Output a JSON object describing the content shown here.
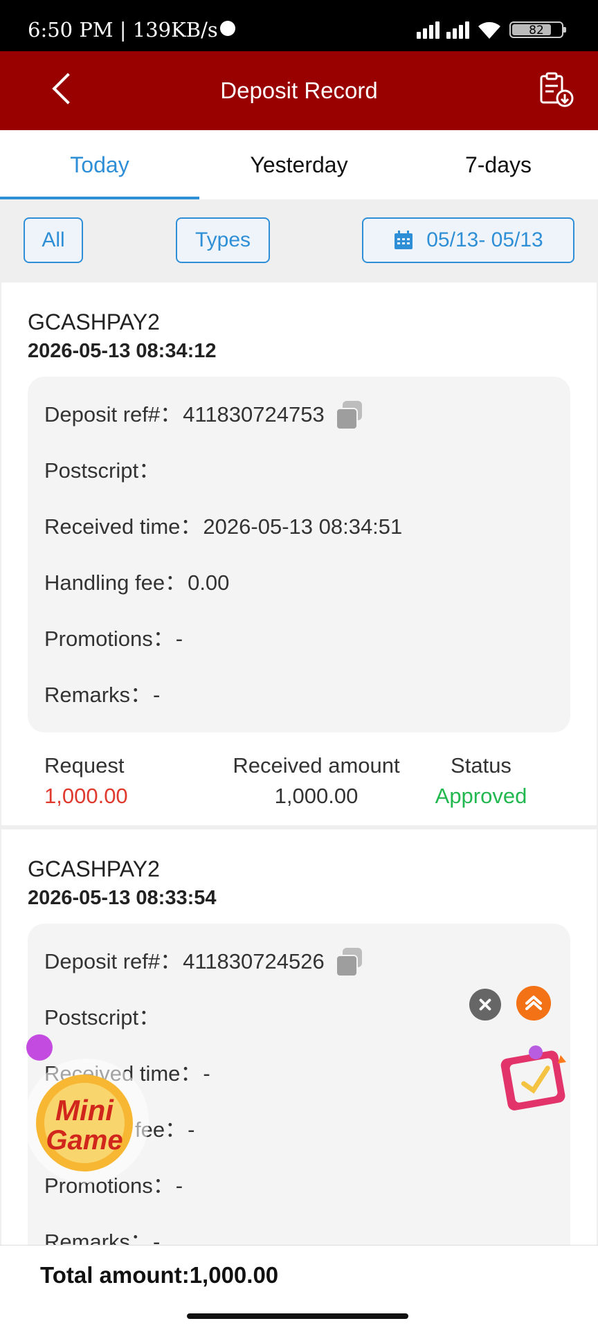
{
  "status_bar": {
    "time": "6:50 PM",
    "separator": "|",
    "speed": "139KB/s",
    "battery": "82"
  },
  "header": {
    "title": "Deposit Record",
    "back_icon": "chevron-left-icon",
    "export_icon": "clipboard-download-icon"
  },
  "tabs": [
    {
      "label": "Today",
      "active": true
    },
    {
      "label": "Yesterday",
      "active": false
    },
    {
      "label": "7-days",
      "active": false
    }
  ],
  "filters": {
    "all": "All",
    "types": "Types",
    "date_range": "05/13- 05/13"
  },
  "records": [
    {
      "channel": "GCASHPAY2",
      "datetime": "2026-05-13 08:34:12",
      "ref_label": "Deposit ref#：",
      "ref": "411830724753",
      "postscript_label": "Postscript：",
      "postscript": "",
      "received_time_label": "Received time：",
      "received_time": "2026-05-13 08:34:51",
      "fee_label": "Handling fee：",
      "fee": "0.00",
      "promotions_label": "Promotions：",
      "promotions": "-",
      "remarks_label": "Remarks：",
      "remarks": "-",
      "request_label": "Request",
      "request": "1,000.00",
      "received_amount_label": "Received amount",
      "received_amount": "1,000.00",
      "status_label": "Status",
      "status": "Approved"
    },
    {
      "channel": "GCASHPAY2",
      "datetime": "2026-05-13 08:33:54",
      "ref_label": "Deposit ref#：",
      "ref": "411830724526",
      "postscript_label": "Postscript：",
      "postscript": "",
      "received_time_label": "Received time：",
      "received_time": "-",
      "fee_label": "Handling fee：",
      "fee": "-",
      "promotions_label": "Promotions：",
      "promotions": "-",
      "remarks_label": "Remarks：",
      "remarks": "-"
    }
  ],
  "footer": {
    "total_label": "Total amount:",
    "total": "1,000.00"
  },
  "floating": {
    "mini_game_logo_text": "Mini Game"
  },
  "colors": {
    "header": "#990000",
    "accent": "#2f8fd6",
    "request": "#e03a2f",
    "approved": "#22b84f"
  }
}
